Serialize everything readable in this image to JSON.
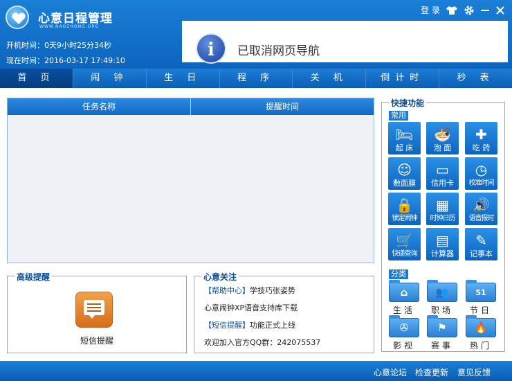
{
  "app": {
    "title": "心意日程管理",
    "subtitle": "WWW.NAOZHONG.ORG"
  },
  "header": {
    "boot_label": "开机时间：",
    "boot_value": "0天9小时25分34秒",
    "now_label": "现在时间：",
    "now_value": "2016-03-17  17:49:10",
    "login_label": "登 录"
  },
  "banner": {
    "text": "已取消网页导航"
  },
  "tabs": [
    "首 页",
    "闹 钟",
    "生 日",
    "程 序",
    "关 机",
    "倒计时",
    "秒 表"
  ],
  "table": {
    "col1": "任务名称",
    "col2": "提醒时间"
  },
  "advanced": {
    "title": "高级提醒",
    "sms_label": "短信提醒"
  },
  "focus": {
    "title": "心意关注",
    "lines": [
      {
        "bracket": "【帮助中心】",
        "text": "学技巧张姿势"
      },
      {
        "bracket": "",
        "text": "心意闹钟XP语音支持库下载"
      },
      {
        "bracket": "【短信提醒】",
        "text": "功能正式上线"
      },
      {
        "bracket": "",
        "text": "欢迎加入官方QQ群：242075537"
      }
    ]
  },
  "quick": {
    "title": "快捷功能",
    "common_label": "常用",
    "items": [
      {
        "label": "起 床",
        "icon": "bed-icon"
      },
      {
        "label": "泡 面",
        "icon": "noodle-bowl-icon"
      },
      {
        "label": "吃 药",
        "icon": "medicine-kit-icon"
      },
      {
        "label": "敷面膜",
        "icon": "face-mask-icon"
      },
      {
        "label": "信用卡",
        "icon": "credit-card-icon"
      },
      {
        "label": "校准时间",
        "icon": "clock-sync-icon"
      },
      {
        "label": "锁定闹钟",
        "icon": "lock-icon"
      },
      {
        "label": "时钟日历",
        "icon": "calendar-icon"
      },
      {
        "label": "语音报时",
        "icon": "speaker-icon"
      },
      {
        "label": "快递查询",
        "icon": "cart-icon"
      },
      {
        "label": "计算器",
        "icon": "calculator-icon"
      },
      {
        "label": "记事本",
        "icon": "notepad-icon"
      }
    ],
    "category_label": "分类",
    "categories": [
      {
        "label": "生活",
        "icon": "home-icon"
      },
      {
        "label": "职场",
        "icon": "people-icon"
      },
      {
        "label": "节日",
        "icon": "calendar-51-icon",
        "date": "51"
      },
      {
        "label": "影视",
        "icon": "film-reel-icon"
      },
      {
        "label": "赛事",
        "icon": "flag-icon"
      },
      {
        "label": "热门",
        "icon": "flame-icon"
      }
    ]
  },
  "footer": {
    "forum": "心意论坛",
    "update": "检查更新",
    "feedback": "意见反馈"
  }
}
